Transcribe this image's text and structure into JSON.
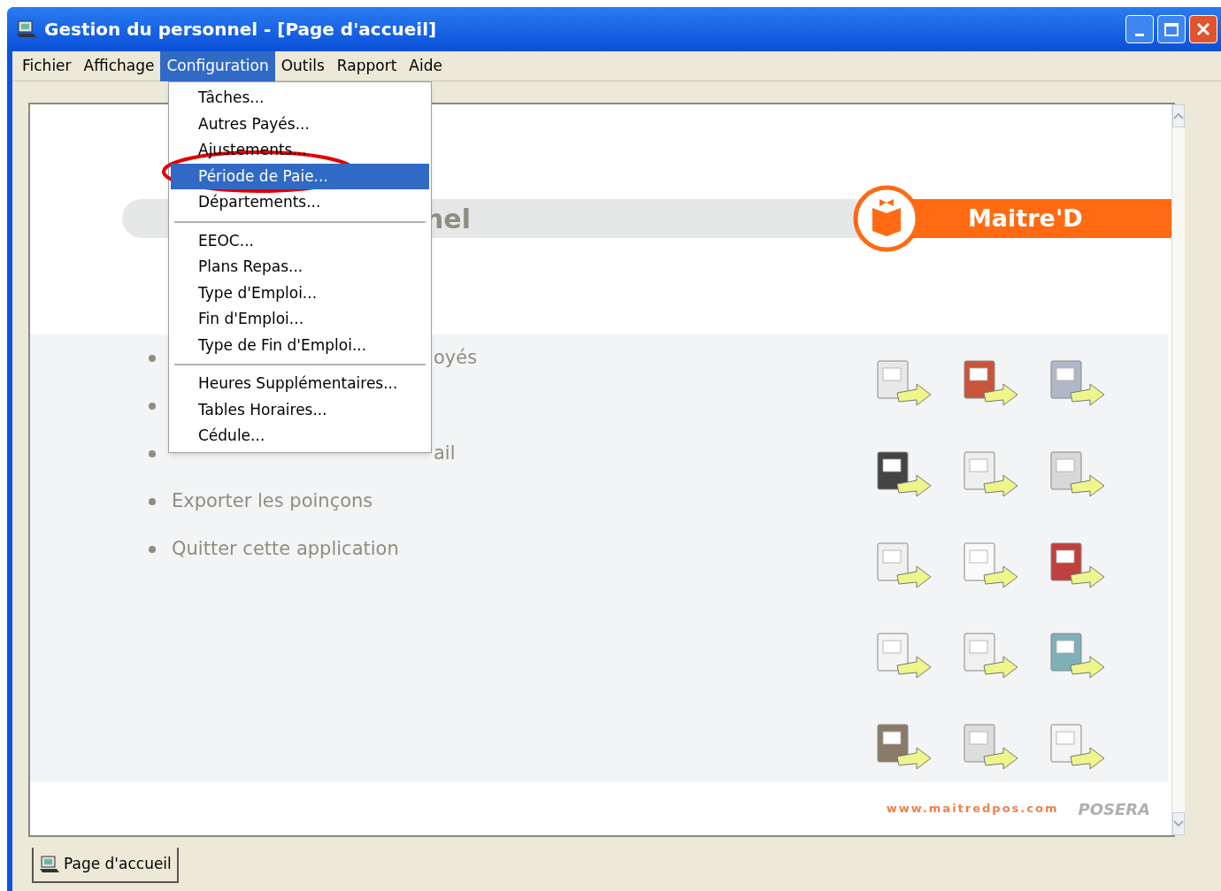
{
  "window": {
    "title": "Gestion du personnel - [Page d'accueil]"
  },
  "menu_bar": [
    {
      "label": "Fichier",
      "selected": false
    },
    {
      "label": "Affichage",
      "selected": false
    },
    {
      "label": "Configuration",
      "selected": true
    },
    {
      "label": "Outils",
      "selected": false
    },
    {
      "label": "Rapport",
      "selected": false
    },
    {
      "label": "Aide",
      "selected": false
    }
  ],
  "dropdown": [
    {
      "kind": "item",
      "label": "Tâches...",
      "selected": false
    },
    {
      "kind": "item",
      "label": "Autres Payés...",
      "selected": false
    },
    {
      "kind": "item",
      "label": "Ajustements...",
      "selected": false
    },
    {
      "kind": "item",
      "label": "Période de Paie...",
      "selected": true
    },
    {
      "kind": "item",
      "label": "Départements...",
      "selected": false
    },
    {
      "kind": "separator"
    },
    {
      "kind": "item",
      "label": "EEOC...",
      "selected": false
    },
    {
      "kind": "item",
      "label": "Plans Repas...",
      "selected": false
    },
    {
      "kind": "item",
      "label": "Type d'Emploi...",
      "selected": false
    },
    {
      "kind": "item",
      "label": "Fin d'Emploi...",
      "selected": false
    },
    {
      "kind": "item",
      "label": "Type de Fin d'Emploi...",
      "selected": false
    },
    {
      "kind": "separator"
    },
    {
      "kind": "item",
      "label": "Heures Supplémentaires...",
      "selected": false
    },
    {
      "kind": "item",
      "label": "Tables Horaires...",
      "selected": false
    },
    {
      "kind": "item",
      "label": "Cédule...",
      "selected": false
    }
  ],
  "page": {
    "heading": "nel",
    "logo_text": "Maitre'D",
    "links": [
      {
        "kind": "covered",
        "text": "oyés"
      },
      {
        "kind": "hidden"
      },
      {
        "kind": "covered",
        "text": "ail"
      },
      {
        "kind": "full",
        "text": "Exporter les poinçons"
      },
      {
        "kind": "full",
        "text": "Quitter cette application"
      }
    ],
    "website": "www.maitredpos.com",
    "brand": "POSERA"
  },
  "tabs": [
    {
      "label": "Page d'accueil",
      "selected": true
    }
  ]
}
